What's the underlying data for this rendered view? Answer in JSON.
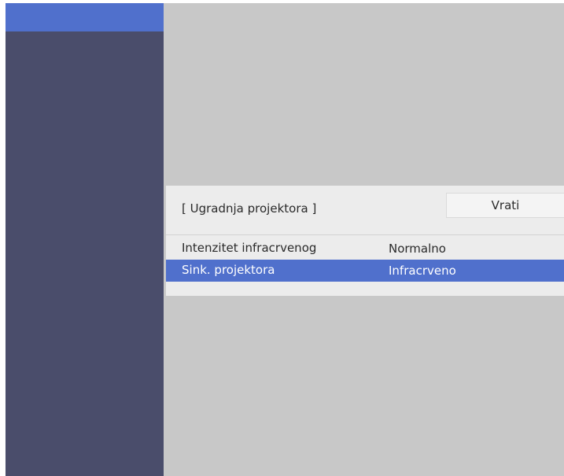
{
  "colors": {
    "screen_background": "#c8c8c8",
    "sidebar_background": "#4a4d6b",
    "accent_selection": "#5070cc",
    "panel_background": "#ececec"
  },
  "panel": {
    "title": "[ Ugradnja projektora ]",
    "back_label": "Vrati",
    "rows": [
      {
        "label": "Intenzitet infracrvenog",
        "value": "Normalno",
        "selected": false
      },
      {
        "label": "Sink. projektora",
        "value": "Infracrveno",
        "selected": true
      }
    ]
  }
}
